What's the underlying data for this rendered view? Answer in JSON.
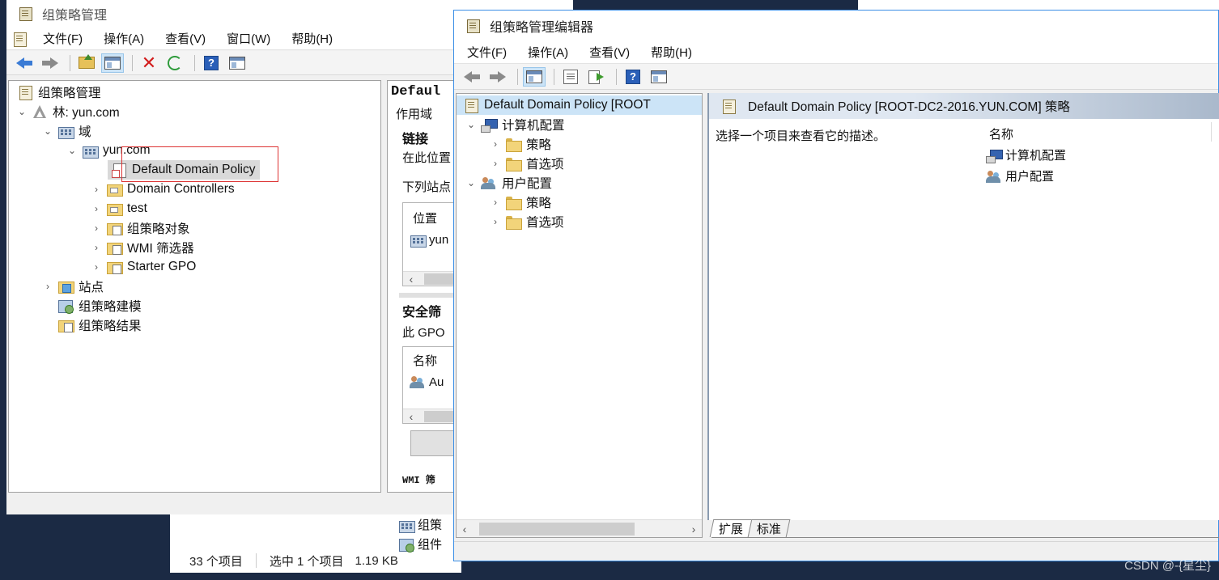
{
  "gpm": {
    "title": "组策略管理",
    "menu": [
      "文件(F)",
      "操作(A)",
      "查看(V)",
      "窗口(W)",
      "帮助(H)"
    ],
    "tree": {
      "root": "组策略管理",
      "forest": "林: yun.com",
      "domains": "域",
      "domain": "yun.com",
      "default_policy": "Default Domain Policy",
      "domain_controllers": "Domain Controllers",
      "test": "test",
      "gpo_objects": "组策略对象",
      "wmi_filters": "WMI 筛选器",
      "starter_gpo": "Starter GPO",
      "sites": "站点",
      "modeling": "组策略建模",
      "results": "组策略结果"
    }
  },
  "details": {
    "title": "Defaul",
    "scope_tab": "作用域",
    "links_heading": "链接",
    "links_text": "在此位置",
    "links_desc": "下列站点",
    "location_col": "位置",
    "location_value": "yun",
    "security_heading": "安全筛",
    "security_text": "此 GPO",
    "name_col": "名称",
    "name_value": "Au",
    "wmi_heading": "WMI 筛",
    "bottom_item1": "组策",
    "bottom_item2": "组件"
  },
  "status_bar": {
    "items": "33 个项目",
    "selected": "选中 1 个项目",
    "size": "1.19 KB"
  },
  "editor": {
    "title": "组策略管理编辑器",
    "menu": [
      "文件(F)",
      "操作(A)",
      "查看(V)",
      "帮助(H)"
    ],
    "tree": {
      "root": "Default Domain Policy [ROOT",
      "computer_config": "计算机配置",
      "policies": "策略",
      "preferences": "首选项",
      "user_config": "用户配置",
      "policies2": "策略",
      "preferences2": "首选项"
    },
    "content": {
      "header": "Default Domain Policy [ROOT-DC2-2016.YUN.COM] 策略",
      "description": "选择一个项目来查看它的描述。",
      "name_col": "名称",
      "items": [
        "计算机配置",
        "用户配置"
      ]
    },
    "tabs": [
      "扩展",
      "标准"
    ]
  },
  "watermark": "CSDN @-{星尘}"
}
